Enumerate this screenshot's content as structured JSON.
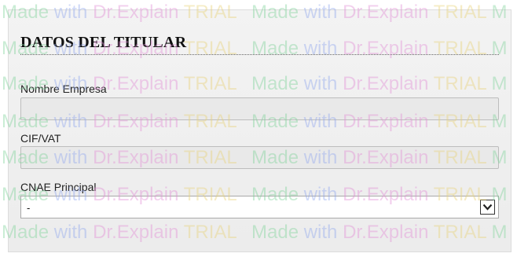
{
  "form": {
    "title": "DATOS DEL TITULAR",
    "fields": [
      {
        "label": "Nombre Empresa",
        "value": ""
      },
      {
        "label": "CIF/VAT",
        "value": ""
      }
    ],
    "select": {
      "label": "CNAE Principal",
      "value": "-",
      "icon": "chevron-down-icon"
    }
  },
  "watermark": {
    "made": "Made",
    "with": "with",
    "dr": "Dr.Explain",
    "trial": "TRIAL",
    "tail": "M"
  },
  "colors": {
    "panel_bg": "#f0f0f0",
    "field_bg": "#e9e9e9",
    "wm_made": "#7fd39a",
    "wm_with": "#8fa6ee",
    "wm_dr": "#e28fd6",
    "wm_trial": "#e8d27a"
  }
}
